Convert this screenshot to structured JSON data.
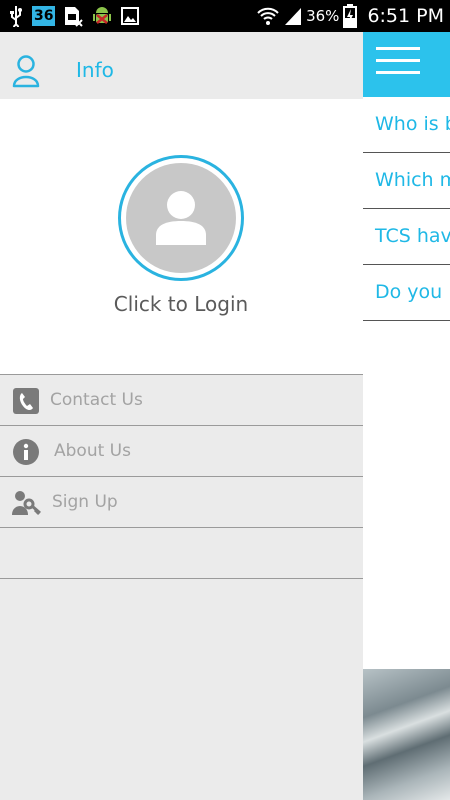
{
  "status_bar": {
    "notification_badge": "36",
    "battery_percent": "36%",
    "time": "6:51 PM",
    "icons": [
      "usb-icon",
      "sim-icon",
      "android-icon",
      "image-icon",
      "wifi-icon",
      "signal-icon",
      "battery-icon"
    ]
  },
  "drawer": {
    "header_title": "Info",
    "login_label": "Click to Login",
    "menu": [
      {
        "label": "Contact Us",
        "icon": "phone-icon"
      },
      {
        "label": "About Us",
        "icon": "info-icon"
      },
      {
        "label": "Sign Up",
        "icon": "key-person-icon"
      }
    ]
  },
  "content": {
    "faq_items": [
      "Who is b",
      "Which m",
      "TCS hav",
      "Do you l"
    ]
  },
  "colors": {
    "accent": "#2cc2ec",
    "link_text": "#1fb8e6",
    "drawer_bg": "#ebebeb",
    "menu_text": "#a3a3a3"
  }
}
